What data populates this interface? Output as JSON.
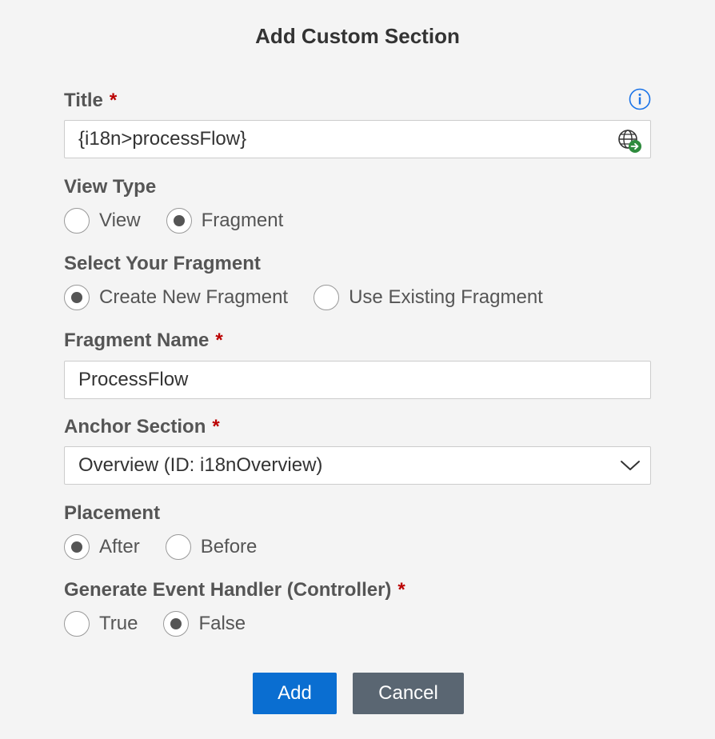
{
  "dialog": {
    "title": "Add Custom Section"
  },
  "required_marker": "*",
  "title_field": {
    "label": "Title",
    "value": "{i18n>processFlow}"
  },
  "view_type": {
    "label": "View Type",
    "options": [
      {
        "label": "View",
        "selected": false
      },
      {
        "label": "Fragment",
        "selected": true
      }
    ]
  },
  "select_fragment": {
    "label": "Select Your Fragment",
    "options": [
      {
        "label": "Create New Fragment",
        "selected": true
      },
      {
        "label": "Use Existing Fragment",
        "selected": false
      }
    ]
  },
  "fragment_name": {
    "label": "Fragment Name",
    "value": "ProcessFlow"
  },
  "anchor_section": {
    "label": "Anchor Section",
    "value": "Overview (ID: i18nOverview)"
  },
  "placement": {
    "label": "Placement",
    "options": [
      {
        "label": "After",
        "selected": true
      },
      {
        "label": "Before",
        "selected": false
      }
    ]
  },
  "event_handler": {
    "label": "Generate Event Handler (Controller)",
    "options": [
      {
        "label": "True",
        "selected": false
      },
      {
        "label": "False",
        "selected": true
      }
    ]
  },
  "buttons": {
    "add": "Add",
    "cancel": "Cancel"
  },
  "colors": {
    "primary": "#0a6ed1",
    "secondary": "#5a6672",
    "required": "#bb0000",
    "info": "#1a73e8",
    "globe_badge": "#2e8b3d"
  },
  "icons": {
    "info": "info-icon",
    "globe": "globe-arrow-icon",
    "dropdown": "chevron-down-icon"
  }
}
